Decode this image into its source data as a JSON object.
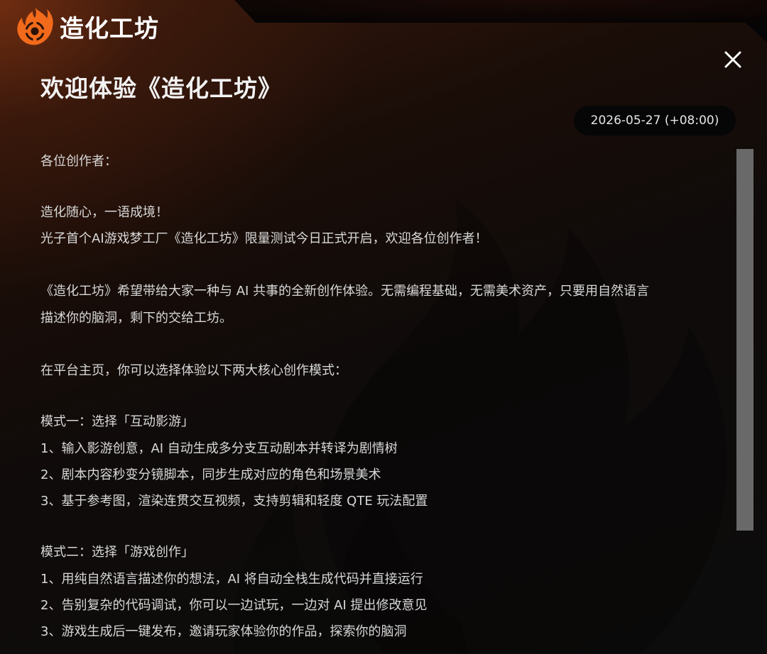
{
  "logo": {
    "text": "造化工坊"
  },
  "title": "欢迎体验《造化工坊》",
  "date": "2026-05-27 (+08:00)",
  "content": {
    "greeting": "各位创作者：",
    "intro_1": "造化随心，一语成境！",
    "intro_2": "光子首个AI游戏梦工厂《造化工坊》限量测试今日正式开启，欢迎各位创作者！",
    "desc_1": "《造化工坊》希望带给大家一种与 AI 共事的全新创作体验。无需编程基础，无需美术资产，只要用自然语言",
    "desc_2": "描述你的脑洞，剩下的交给工坊。",
    "modes_intro": "在平台主页，你可以选择体验以下两大核心创作模式：",
    "mode1": {
      "heading": "模式一：选择「互动影游」",
      "items": [
        "1、输入影游创意，AI 自动生成多分支互动剧本并转译为剧情树",
        "2、剧本内容秒变分镜脚本，同步生成对应的角色和场景美术",
        "3、基于参考图，渲染连贯交互视频，支持剪辑和轻度 QTE 玩法配置"
      ]
    },
    "mode2": {
      "heading": "模式二：选择「游戏创作」",
      "items": [
        "1、用纯自然语言描述你的想法，AI 将自动全栈生成代码并直接运行",
        "2、告别复杂的代码调试，你可以一边试玩，一边对 AI 提出修改意见",
        "3、游戏生成后一键发布，邀请玩家体验你的作品，探索你的脑洞"
      ]
    }
  },
  "icons": {
    "logo": "flame-gear-icon",
    "close": "close-icon"
  },
  "colors": {
    "accent": "#f26a1b",
    "text": "#d8d8d8",
    "title": "#f2f2f2"
  }
}
